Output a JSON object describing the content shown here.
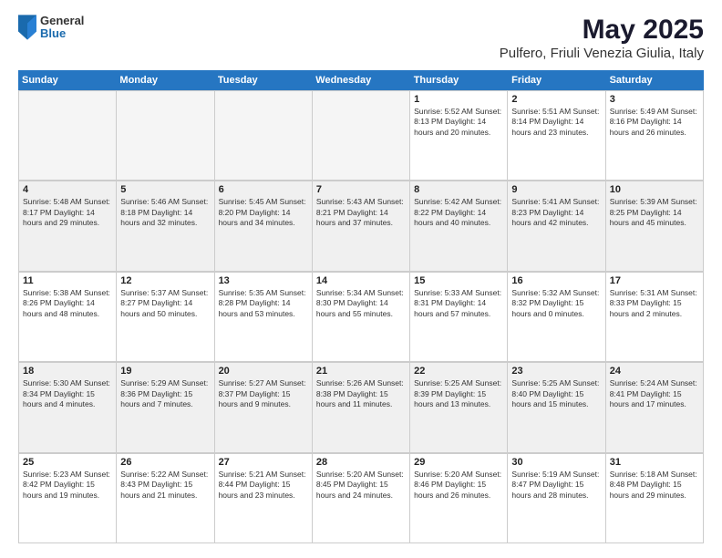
{
  "logo": {
    "general": "General",
    "blue": "Blue"
  },
  "title": "May 2025",
  "subtitle": "Pulfero, Friuli Venezia Giulia, Italy",
  "days_of_week": [
    "Sunday",
    "Monday",
    "Tuesday",
    "Wednesday",
    "Thursday",
    "Friday",
    "Saturday"
  ],
  "weeks": [
    [
      {
        "day": "",
        "info": "",
        "empty": true
      },
      {
        "day": "",
        "info": "",
        "empty": true
      },
      {
        "day": "",
        "info": "",
        "empty": true
      },
      {
        "day": "",
        "info": "",
        "empty": true
      },
      {
        "day": "1",
        "info": "Sunrise: 5:52 AM\nSunset: 8:13 PM\nDaylight: 14 hours\nand 20 minutes."
      },
      {
        "day": "2",
        "info": "Sunrise: 5:51 AM\nSunset: 8:14 PM\nDaylight: 14 hours\nand 23 minutes."
      },
      {
        "day": "3",
        "info": "Sunrise: 5:49 AM\nSunset: 8:16 PM\nDaylight: 14 hours\nand 26 minutes."
      }
    ],
    [
      {
        "day": "4",
        "info": "Sunrise: 5:48 AM\nSunset: 8:17 PM\nDaylight: 14 hours\nand 29 minutes."
      },
      {
        "day": "5",
        "info": "Sunrise: 5:46 AM\nSunset: 8:18 PM\nDaylight: 14 hours\nand 32 minutes."
      },
      {
        "day": "6",
        "info": "Sunrise: 5:45 AM\nSunset: 8:20 PM\nDaylight: 14 hours\nand 34 minutes."
      },
      {
        "day": "7",
        "info": "Sunrise: 5:43 AM\nSunset: 8:21 PM\nDaylight: 14 hours\nand 37 minutes."
      },
      {
        "day": "8",
        "info": "Sunrise: 5:42 AM\nSunset: 8:22 PM\nDaylight: 14 hours\nand 40 minutes."
      },
      {
        "day": "9",
        "info": "Sunrise: 5:41 AM\nSunset: 8:23 PM\nDaylight: 14 hours\nand 42 minutes."
      },
      {
        "day": "10",
        "info": "Sunrise: 5:39 AM\nSunset: 8:25 PM\nDaylight: 14 hours\nand 45 minutes."
      }
    ],
    [
      {
        "day": "11",
        "info": "Sunrise: 5:38 AM\nSunset: 8:26 PM\nDaylight: 14 hours\nand 48 minutes."
      },
      {
        "day": "12",
        "info": "Sunrise: 5:37 AM\nSunset: 8:27 PM\nDaylight: 14 hours\nand 50 minutes."
      },
      {
        "day": "13",
        "info": "Sunrise: 5:35 AM\nSunset: 8:28 PM\nDaylight: 14 hours\nand 53 minutes."
      },
      {
        "day": "14",
        "info": "Sunrise: 5:34 AM\nSunset: 8:30 PM\nDaylight: 14 hours\nand 55 minutes."
      },
      {
        "day": "15",
        "info": "Sunrise: 5:33 AM\nSunset: 8:31 PM\nDaylight: 14 hours\nand 57 minutes."
      },
      {
        "day": "16",
        "info": "Sunrise: 5:32 AM\nSunset: 8:32 PM\nDaylight: 15 hours\nand 0 minutes."
      },
      {
        "day": "17",
        "info": "Sunrise: 5:31 AM\nSunset: 8:33 PM\nDaylight: 15 hours\nand 2 minutes."
      }
    ],
    [
      {
        "day": "18",
        "info": "Sunrise: 5:30 AM\nSunset: 8:34 PM\nDaylight: 15 hours\nand 4 minutes."
      },
      {
        "day": "19",
        "info": "Sunrise: 5:29 AM\nSunset: 8:36 PM\nDaylight: 15 hours\nand 7 minutes."
      },
      {
        "day": "20",
        "info": "Sunrise: 5:27 AM\nSunset: 8:37 PM\nDaylight: 15 hours\nand 9 minutes."
      },
      {
        "day": "21",
        "info": "Sunrise: 5:26 AM\nSunset: 8:38 PM\nDaylight: 15 hours\nand 11 minutes."
      },
      {
        "day": "22",
        "info": "Sunrise: 5:25 AM\nSunset: 8:39 PM\nDaylight: 15 hours\nand 13 minutes."
      },
      {
        "day": "23",
        "info": "Sunrise: 5:25 AM\nSunset: 8:40 PM\nDaylight: 15 hours\nand 15 minutes."
      },
      {
        "day": "24",
        "info": "Sunrise: 5:24 AM\nSunset: 8:41 PM\nDaylight: 15 hours\nand 17 minutes."
      }
    ],
    [
      {
        "day": "25",
        "info": "Sunrise: 5:23 AM\nSunset: 8:42 PM\nDaylight: 15 hours\nand 19 minutes."
      },
      {
        "day": "26",
        "info": "Sunrise: 5:22 AM\nSunset: 8:43 PM\nDaylight: 15 hours\nand 21 minutes."
      },
      {
        "day": "27",
        "info": "Sunrise: 5:21 AM\nSunset: 8:44 PM\nDaylight: 15 hours\nand 23 minutes."
      },
      {
        "day": "28",
        "info": "Sunrise: 5:20 AM\nSunset: 8:45 PM\nDaylight: 15 hours\nand 24 minutes."
      },
      {
        "day": "29",
        "info": "Sunrise: 5:20 AM\nSunset: 8:46 PM\nDaylight: 15 hours\nand 26 minutes."
      },
      {
        "day": "30",
        "info": "Sunrise: 5:19 AM\nSunset: 8:47 PM\nDaylight: 15 hours\nand 28 minutes."
      },
      {
        "day": "31",
        "info": "Sunrise: 5:18 AM\nSunset: 8:48 PM\nDaylight: 15 hours\nand 29 minutes."
      }
    ]
  ]
}
